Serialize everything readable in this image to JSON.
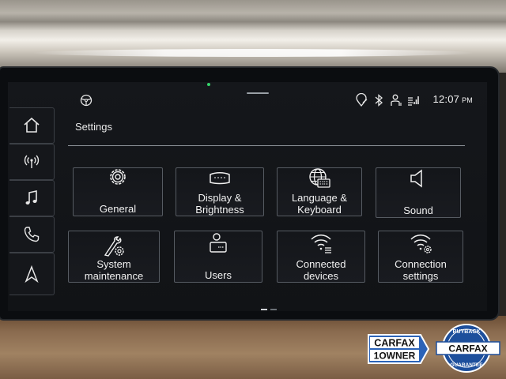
{
  "status": {
    "time": "12:07",
    "ampm": "PM",
    "icons": [
      "steering-wheel-icon",
      "location-pin-icon",
      "bluetooth-icon",
      "user-icon",
      "phone-signal-icon"
    ]
  },
  "header": {
    "title": "Settings"
  },
  "rail": {
    "items": [
      "home-icon",
      "radio-icon",
      "music-note-icon",
      "phone-icon",
      "navigation-arrow-icon"
    ]
  },
  "tiles": [
    {
      "line1": "General",
      "line2": "",
      "icon": "gear-icon"
    },
    {
      "line1": "Display &",
      "line2": "Brightness",
      "icon": "display-icon"
    },
    {
      "line1": "Language &",
      "line2": "Keyboard",
      "icon": "globe-keyboard-icon"
    },
    {
      "line1": "Sound",
      "line2": "",
      "icon": "speaker-icon"
    },
    {
      "line1": "System",
      "line2": "maintenance",
      "icon": "tools-gear-icon"
    },
    {
      "line1": "Users",
      "line2": "",
      "icon": "user-card-icon"
    },
    {
      "line1": "Connected",
      "line2": "devices",
      "icon": "wifi-list-icon"
    },
    {
      "line1": "Connection",
      "line2": "settings",
      "icon": "wifi-gear-icon"
    }
  ],
  "badges": {
    "carfax_one_owner": {
      "line1": "CARFAX",
      "line2": "1OWNER"
    },
    "carfax_buyback": {
      "top": "BUYBACK",
      "middle": "CARFAX",
      "bottom": "GUARANTEE"
    }
  },
  "colors": {
    "accent": "#f1f1f1",
    "screen_bg": "#15171b",
    "tile_border": "#565b62",
    "carfax_blue": "#1d4f9c"
  }
}
